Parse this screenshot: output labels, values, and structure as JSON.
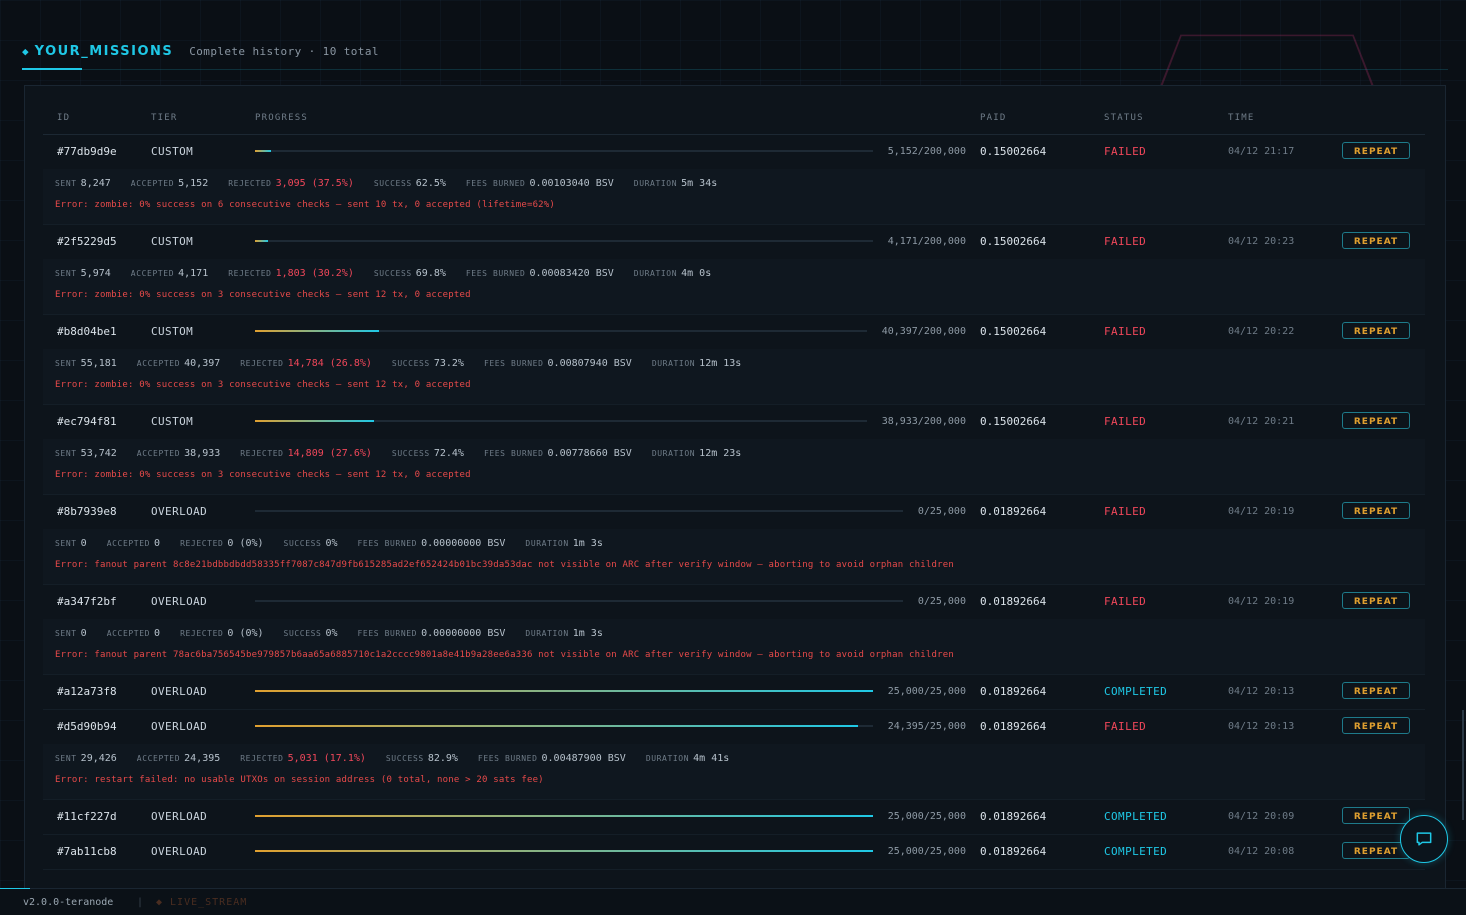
{
  "header": {
    "title": "YOUR_MISSIONS",
    "subtitle": "Complete history · 10 total"
  },
  "table": {
    "columns": {
      "id": "ID",
      "tier": "TIER",
      "progress": "PROGRESS",
      "paid": "PAID",
      "status": "STATUS",
      "time": "TIME"
    },
    "rows": [
      {
        "id": "#77db9d9e",
        "tier": "CUSTOM",
        "progress": 0.026,
        "count": "5,152/200,000",
        "paid": "0.15002664",
        "status": "FAILED",
        "time": "04/12 21:17",
        "action": "REPEAT"
      },
      {
        "id": "#2f5229d5",
        "tier": "CUSTOM",
        "progress": 0.021,
        "count": "4,171/200,000",
        "paid": "0.15002664",
        "status": "FAILED",
        "time": "04/12 20:23",
        "action": "REPEAT"
      },
      {
        "id": "#b8d04be1",
        "tier": "CUSTOM",
        "progress": 0.202,
        "count": "40,397/200,000",
        "paid": "0.15002664",
        "status": "FAILED",
        "time": "04/12 20:22",
        "action": "REPEAT"
      },
      {
        "id": "#ec794f81",
        "tier": "CUSTOM",
        "progress": 0.195,
        "count": "38,933/200,000",
        "paid": "0.15002664",
        "status": "FAILED",
        "time": "04/12 20:21",
        "action": "REPEAT"
      },
      {
        "id": "#8b7939e8",
        "tier": "OVERLOAD",
        "progress": 0,
        "count": "0/25,000",
        "paid": "0.01892664",
        "status": "FAILED",
        "time": "04/12 20:19",
        "action": "REPEAT"
      },
      {
        "id": "#a347f2bf",
        "tier": "OVERLOAD",
        "progress": 0,
        "count": "0/25,000",
        "paid": "0.01892664",
        "status": "FAILED",
        "time": "04/12 20:19",
        "action": "REPEAT"
      },
      {
        "id": "#a12a73f8",
        "tier": "OVERLOAD",
        "progress": 1.0,
        "count": "25,000/25,000",
        "paid": "0.01892664",
        "status": "COMPLETED",
        "time": "04/12 20:13",
        "action": "REPEAT"
      },
      {
        "id": "#d5d90b94",
        "tier": "OVERLOAD",
        "progress": 0.976,
        "count": "24,395/25,000",
        "paid": "0.01892664",
        "status": "FAILED",
        "time": "04/12 20:13",
        "action": "REPEAT"
      },
      {
        "id": "#11cf227d",
        "tier": "OVERLOAD",
        "progress": 1.0,
        "count": "25,000/25,000",
        "paid": "0.01892664",
        "status": "COMPLETED",
        "time": "04/12 20:09",
        "action": "REPEAT"
      },
      {
        "id": "#7ab11cb8",
        "tier": "OVERLOAD",
        "progress": 1.0,
        "count": "25,000/25,000",
        "paid": "0.01892664",
        "status": "COMPLETED",
        "time": "04/12 20:08",
        "action": "REPEAT"
      }
    ],
    "details": [
      {
        "sent": "8,247",
        "accepted": "5,152",
        "rejected": "3,095 (37.5%)",
        "success": "62.5%",
        "fees": "0.00103040 BSV",
        "duration": "5m 34s",
        "error": "Error: zombie: 0% success on 6 consecutive checks — sent 10 tx, 0 accepted (lifetime=62%)"
      },
      {
        "sent": "5,974",
        "accepted": "4,171",
        "rejected": "1,803 (30.2%)",
        "success": "69.8%",
        "fees": "0.00083420 BSV",
        "duration": "4m 0s",
        "error": "Error: zombie: 0% success on 3 consecutive checks — sent 12 tx, 0 accepted"
      },
      {
        "sent": "55,181",
        "accepted": "40,397",
        "rejected": "14,784 (26.8%)",
        "success": "73.2%",
        "fees": "0.00807940 BSV",
        "duration": "12m 13s",
        "error": "Error: zombie: 0% success on 3 consecutive checks — sent 12 tx, 0 accepted"
      },
      {
        "sent": "53,742",
        "accepted": "38,933",
        "rejected": "14,809 (27.6%)",
        "success": "72.4%",
        "fees": "0.00778660 BSV",
        "duration": "12m 23s",
        "error": "Error: zombie: 0% success on 3 consecutive checks — sent 12 tx, 0 accepted"
      },
      {
        "sent": "0",
        "accepted": "0",
        "rejected": "0 (0%)",
        "success": "0%",
        "fees": "0.00000000 BSV",
        "duration": "1m 3s",
        "error": "Error: fanout parent 8c8e21bdbbdbdd58335ff7087c847d9fb615285ad2ef652424b01bc39da53dac not visible on ARC after verify window — aborting to avoid orphan children"
      },
      {
        "sent": "0",
        "accepted": "0",
        "rejected": "0 (0%)",
        "success": "0%",
        "fees": "0.00000000 BSV",
        "duration": "1m 3s",
        "error": "Error: fanout parent 78ac6ba756545be979857b6aa65a6885710c1a2cccc9801a8e41b9a28ee6a336 not visible on ARC after verify window — aborting to avoid orphan children"
      },
      {
        "sent": "29,426",
        "accepted": "24,395",
        "rejected": "5,031 (17.1%)",
        "success": "82.9%",
        "fees": "0.00487900 BSV",
        "duration": "4m 41s",
        "error": "Error: restart failed: no usable UTXOs on session address (0 total, none > 20 sats fee)"
      }
    ],
    "stat_labels": {
      "sent": "SENT",
      "accepted": "ACCEPTED",
      "rejected": "REJECTED",
      "success": "SUCCESS",
      "fees": "FEES BURNED",
      "duration": "DURATION"
    }
  },
  "footer": {
    "version": "v2.0.0-teranode",
    "separator": "|",
    "stream": "◆ LIVE_STREAM"
  },
  "icons": {
    "chat": "chat-bubble-icon",
    "title_marker": "diamond-icon"
  },
  "colors": {
    "accent": "#1fc8e6",
    "failed": "#f0475a",
    "action": "#e0a030",
    "background": "#0a0f15"
  }
}
